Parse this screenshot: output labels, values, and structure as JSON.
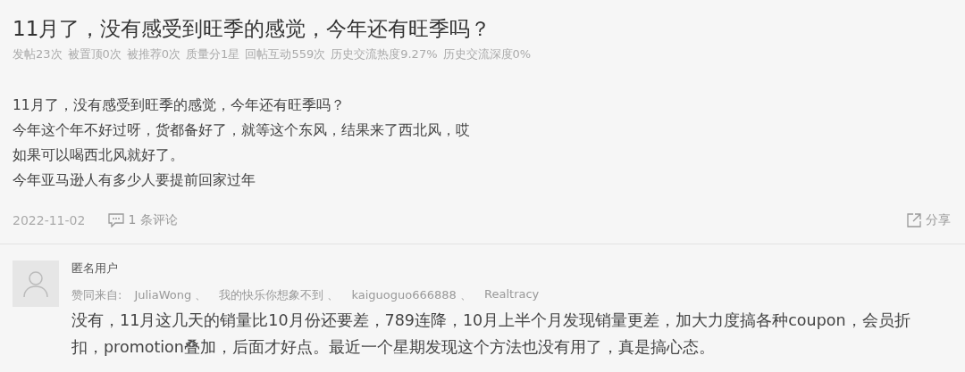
{
  "post": {
    "title": "11月了，没有感受到旺季的感觉，今年还有旺季吗？",
    "stats": [
      "发帖23次",
      "被置顶0次",
      "被推荐0次",
      "质量分1星",
      "回帖互动559次",
      "历史交流热度9.27%",
      "历史交流深度0%"
    ],
    "body": [
      "11月了，没有感受到旺季的感觉，今年还有旺季吗？",
      "今年这个年不好过呀，货都备好了，就等这个东风，结果来了西北风，哎",
      "如果可以喝西北风就好了。",
      "今年亚马逊人有多少人要提前回家过年"
    ],
    "date": "2022-11-02",
    "comments_link": "1 条评论",
    "share": "分享"
  },
  "comment": {
    "author": "匿名用户",
    "likes_label": "赞同来自:",
    "likers": [
      "JuliaWong",
      "我的快乐你想象不到",
      "kaiguoguo666888",
      "Realtracy"
    ],
    "separator": "、",
    "text": "没有，11月这几天的销量比10月份还要差，789连降，10月上半个月发现销量更差，加大力度搞各种coupon，会员折扣，promotion叠加，后面才好点。最近一个星期发现这个方法也没有用了，真是搞心态。"
  }
}
